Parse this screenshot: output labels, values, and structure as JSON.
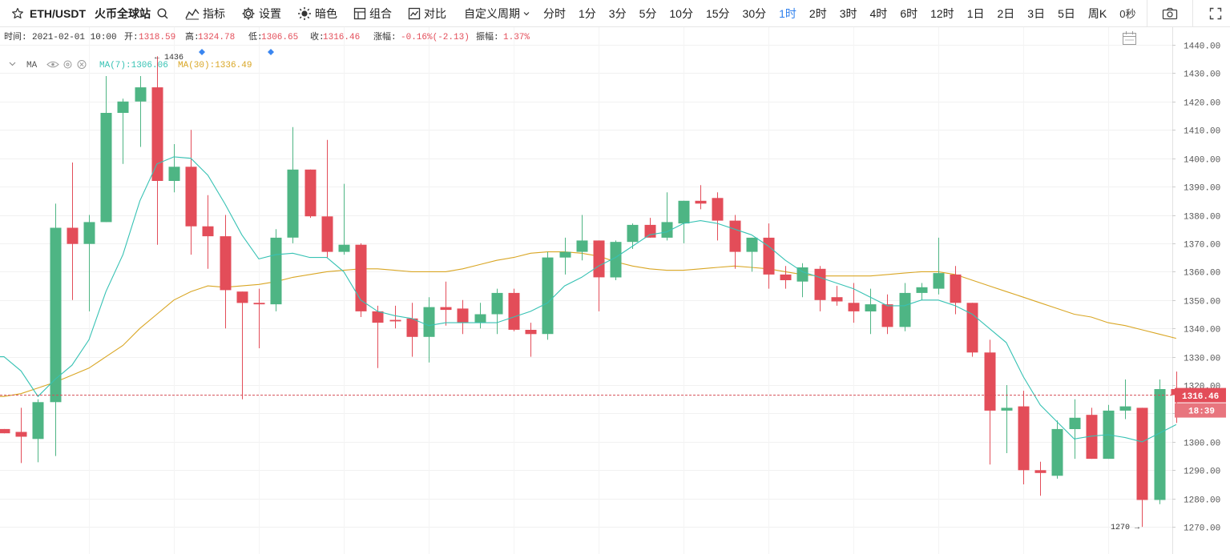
{
  "toolbar": {
    "symbol": "ETH/USDT",
    "exchange": "火币全球站",
    "indicators_label": "指标",
    "settings_label": "设置",
    "theme_label": "暗色",
    "combo_label": "组合",
    "compare_label": "对比",
    "custom_period_label": "自定义周期",
    "periods": [
      "分时",
      "1分",
      "3分",
      "5分",
      "10分",
      "15分",
      "30分",
      "1时",
      "2时",
      "3时",
      "4时",
      "6时",
      "12时",
      "1日",
      "2日",
      "3日",
      "5日",
      "周K"
    ],
    "active_period": "1时",
    "countdown": "0秒"
  },
  "info_bar": {
    "time_label": "时间:",
    "time_value": "2021-02-01 10:00",
    "open_label": "开:",
    "open_value": "1318.59",
    "high_label": "高:",
    "high_value": "1324.78",
    "low_label": "低:",
    "low_value": "1306.65",
    "close_label": "收:",
    "close_value": "1316.46",
    "change_label": "涨幅:",
    "change_value": "-0.16%(-2.13)",
    "amplitude_label": "振幅:",
    "amplitude_value": "1.37%"
  },
  "ma_legend": {
    "label": "MA",
    "ma7_text": "MA(7):1306.06",
    "ma30_text": "MA(30):1336.49"
  },
  "colors": {
    "up": "#4eb584",
    "down": "#e34d59",
    "ma7": "#37c2b4",
    "ma30": "#d9a624",
    "active_period": "#2f80ed"
  },
  "chart_data": {
    "type": "candlestick",
    "interval": "1时",
    "y_ticks": [
      1440.0,
      1430.0,
      1420.0,
      1410.0,
      1400.0,
      1390.0,
      1380.0,
      1370.0,
      1360.0,
      1350.0,
      1340.0,
      1330.0,
      1320.0,
      1310.0,
      1300.0,
      1290.0,
      1280.0,
      1270.0
    ],
    "ylim": [
      1266.5,
      1445
    ],
    "last_price": "1316.46",
    "countdown": "18:39",
    "max_label": "1436",
    "min_label": "1270",
    "candles": [
      {
        "o": 1304.5,
        "h": 1304.5,
        "l": 1303,
        "c": 1303
      },
      {
        "o": 1303.5,
        "h": 1312,
        "l": 1292.5,
        "c": 1301.8
      },
      {
        "o": 1301,
        "h": 1315,
        "l": 1292.8,
        "c": 1314
      },
      {
        "o": 1314,
        "h": 1384,
        "l": 1295,
        "c": 1375.5
      },
      {
        "o": 1375.5,
        "h": 1398.5,
        "l": 1350,
        "c": 1369.8
      },
      {
        "o": 1369.8,
        "h": 1380,
        "l": 1346,
        "c": 1377.5
      },
      {
        "o": 1377.5,
        "h": 1429,
        "l": 1377.5,
        "c": 1416
      },
      {
        "o": 1416,
        "h": 1421,
        "l": 1398,
        "c": 1420
      },
      {
        "o": 1420,
        "h": 1429,
        "l": 1404,
        "c": 1425
      },
      {
        "o": 1425,
        "h": 1436,
        "l": 1369.5,
        "c": 1392
      },
      {
        "o": 1392,
        "h": 1405,
        "l": 1388,
        "c": 1397
      },
      {
        "o": 1397,
        "h": 1410,
        "l": 1366,
        "c": 1376
      },
      {
        "o": 1376,
        "h": 1387,
        "l": 1361,
        "c": 1372.5
      },
      {
        "o": 1372.5,
        "h": 1380,
        "l": 1340,
        "c": 1353.5
      },
      {
        "o": 1353,
        "h": 1353,
        "l": 1315,
        "c": 1349
      },
      {
        "o": 1349,
        "h": 1354,
        "l": 1333,
        "c": 1348.5
      },
      {
        "o": 1348.5,
        "h": 1375,
        "l": 1346,
        "c": 1372
      },
      {
        "o": 1372,
        "h": 1411,
        "l": 1370,
        "c": 1396
      },
      {
        "o": 1396,
        "h": 1396,
        "l": 1379,
        "c": 1379.5
      },
      {
        "o": 1379.5,
        "h": 1406.5,
        "l": 1365,
        "c": 1367
      },
      {
        "o": 1367,
        "h": 1391,
        "l": 1366,
        "c": 1369.5
      },
      {
        "o": 1369.5,
        "h": 1370,
        "l": 1344,
        "c": 1346
      },
      {
        "o": 1346,
        "h": 1348,
        "l": 1326,
        "c": 1342
      },
      {
        "o": 1343,
        "h": 1348,
        "l": 1340,
        "c": 1342.5
      },
      {
        "o": 1343.5,
        "h": 1349,
        "l": 1330,
        "c": 1337
      },
      {
        "o": 1337,
        "h": 1351,
        "l": 1328,
        "c": 1347.5
      },
      {
        "o": 1347.5,
        "h": 1356.5,
        "l": 1341,
        "c": 1346.5
      },
      {
        "o": 1347,
        "h": 1350,
        "l": 1338,
        "c": 1342
      },
      {
        "o": 1342,
        "h": 1349,
        "l": 1340,
        "c": 1345
      },
      {
        "o": 1345,
        "h": 1354,
        "l": 1338,
        "c": 1352.5
      },
      {
        "o": 1352.5,
        "h": 1354,
        "l": 1339,
        "c": 1339.5
      },
      {
        "o": 1339.5,
        "h": 1342,
        "l": 1330,
        "c": 1338
      },
      {
        "o": 1338,
        "h": 1367,
        "l": 1336,
        "c": 1365
      },
      {
        "o": 1365,
        "h": 1372,
        "l": 1359,
        "c": 1367
      },
      {
        "o": 1367,
        "h": 1380,
        "l": 1364,
        "c": 1371
      },
      {
        "o": 1371,
        "h": 1371,
        "l": 1346,
        "c": 1358
      },
      {
        "o": 1358,
        "h": 1371,
        "l": 1357,
        "c": 1370.5
      },
      {
        "o": 1370.5,
        "h": 1377,
        "l": 1368,
        "c": 1376.5
      },
      {
        "o": 1376.5,
        "h": 1379,
        "l": 1372,
        "c": 1372
      },
      {
        "o": 1372,
        "h": 1388,
        "l": 1371,
        "c": 1377.5
      },
      {
        "o": 1377,
        "h": 1385,
        "l": 1370,
        "c": 1385
      },
      {
        "o": 1385,
        "h": 1390.5,
        "l": 1382,
        "c": 1384
      },
      {
        "o": 1386,
        "h": 1388,
        "l": 1371,
        "c": 1378
      },
      {
        "o": 1378,
        "h": 1380,
        "l": 1361,
        "c": 1367
      },
      {
        "o": 1367,
        "h": 1372,
        "l": 1360,
        "c": 1372
      },
      {
        "o": 1372,
        "h": 1377,
        "l": 1354,
        "c": 1359
      },
      {
        "o": 1359,
        "h": 1362,
        "l": 1354,
        "c": 1357
      },
      {
        "o": 1356.5,
        "h": 1363,
        "l": 1351,
        "c": 1361.5
      },
      {
        "o": 1361,
        "h": 1362,
        "l": 1346,
        "c": 1350
      },
      {
        "o": 1351,
        "h": 1355,
        "l": 1348,
        "c": 1349.5
      },
      {
        "o": 1349,
        "h": 1356,
        "l": 1342,
        "c": 1346
      },
      {
        "o": 1346,
        "h": 1354,
        "l": 1338,
        "c": 1348.5
      },
      {
        "o": 1348.5,
        "h": 1352,
        "l": 1338,
        "c": 1340.5
      },
      {
        "o": 1340.5,
        "h": 1356,
        "l": 1339,
        "c": 1352.5
      },
      {
        "o": 1352.5,
        "h": 1356,
        "l": 1350,
        "c": 1354.5
      },
      {
        "o": 1354,
        "h": 1372,
        "l": 1352,
        "c": 1359.5
      },
      {
        "o": 1359,
        "h": 1362,
        "l": 1345,
        "c": 1349
      },
      {
        "o": 1349,
        "h": 1349,
        "l": 1330,
        "c": 1331.5
      },
      {
        "o": 1331.5,
        "h": 1336,
        "l": 1292,
        "c": 1311
      },
      {
        "o": 1311,
        "h": 1320,
        "l": 1296,
        "c": 1312
      },
      {
        "o": 1312.5,
        "h": 1318,
        "l": 1285,
        "c": 1290
      },
      {
        "o": 1290,
        "h": 1293,
        "l": 1281,
        "c": 1289
      },
      {
        "o": 1288,
        "h": 1307.5,
        "l": 1287,
        "c": 1304.5
      },
      {
        "o": 1304.5,
        "h": 1315,
        "l": 1294,
        "c": 1308.5
      },
      {
        "o": 1309.5,
        "h": 1312,
        "l": 1294,
        "c": 1294
      },
      {
        "o": 1294,
        "h": 1313,
        "l": 1294,
        "c": 1311
      },
      {
        "o": 1311,
        "h": 1322,
        "l": 1308,
        "c": 1312.5
      },
      {
        "o": 1312,
        "h": 1312,
        "l": 1270,
        "c": 1279.5
      },
      {
        "o": 1279.5,
        "h": 1322,
        "l": 1278,
        "c": 1318.59
      },
      {
        "o": 1318.59,
        "h": 1324.78,
        "l": 1306.65,
        "c": 1316.46
      }
    ],
    "series": [
      {
        "name": "MA(7)",
        "values": [
          1330,
          1325,
          1316,
          1322,
          1327,
          1336,
          1353,
          1366,
          1385,
          1398,
          1400.5,
          1400,
          1394,
          1384,
          1373,
          1364.5,
          1366,
          1366.5,
          1365,
          1365,
          1360,
          1350,
          1346,
          1344.5,
          1343.5,
          1341,
          1342,
          1342,
          1342,
          1342,
          1344,
          1346,
          1349,
          1355,
          1358,
          1362,
          1365,
          1369,
          1373,
          1374,
          1377,
          1378,
          1377,
          1375,
          1373,
          1369,
          1364,
          1360,
          1358,
          1356,
          1354,
          1351,
          1348,
          1348,
          1350,
          1350,
          1348,
          1345,
          1340,
          1335,
          1323,
          1313,
          1307,
          1301,
          1302,
          1302.5,
          1301.5,
          1300,
          1303,
          1306.06
        ]
      },
      {
        "name": "MA(30)",
        "values": [
          1316,
          1317,
          1319,
          1321,
          1323.5,
          1326,
          1330,
          1334,
          1340,
          1345,
          1350,
          1353,
          1355,
          1354.5,
          1355,
          1355.5,
          1356.5,
          1358,
          1359,
          1360,
          1360.5,
          1361,
          1361,
          1360.5,
          1360,
          1360,
          1360,
          1361,
          1362.5,
          1364,
          1365,
          1366.5,
          1367,
          1367,
          1366.5,
          1365.5,
          1363.5,
          1362,
          1361,
          1360.5,
          1360.5,
          1361,
          1361.5,
          1362,
          1361.5,
          1361,
          1360,
          1359,
          1358.5,
          1358.5,
          1358.5,
          1358.5,
          1359,
          1359.5,
          1360,
          1360,
          1359,
          1357,
          1355,
          1353,
          1351,
          1349,
          1347,
          1345,
          1344,
          1342,
          1341,
          1339.5,
          1338,
          1336.49
        ]
      }
    ]
  }
}
